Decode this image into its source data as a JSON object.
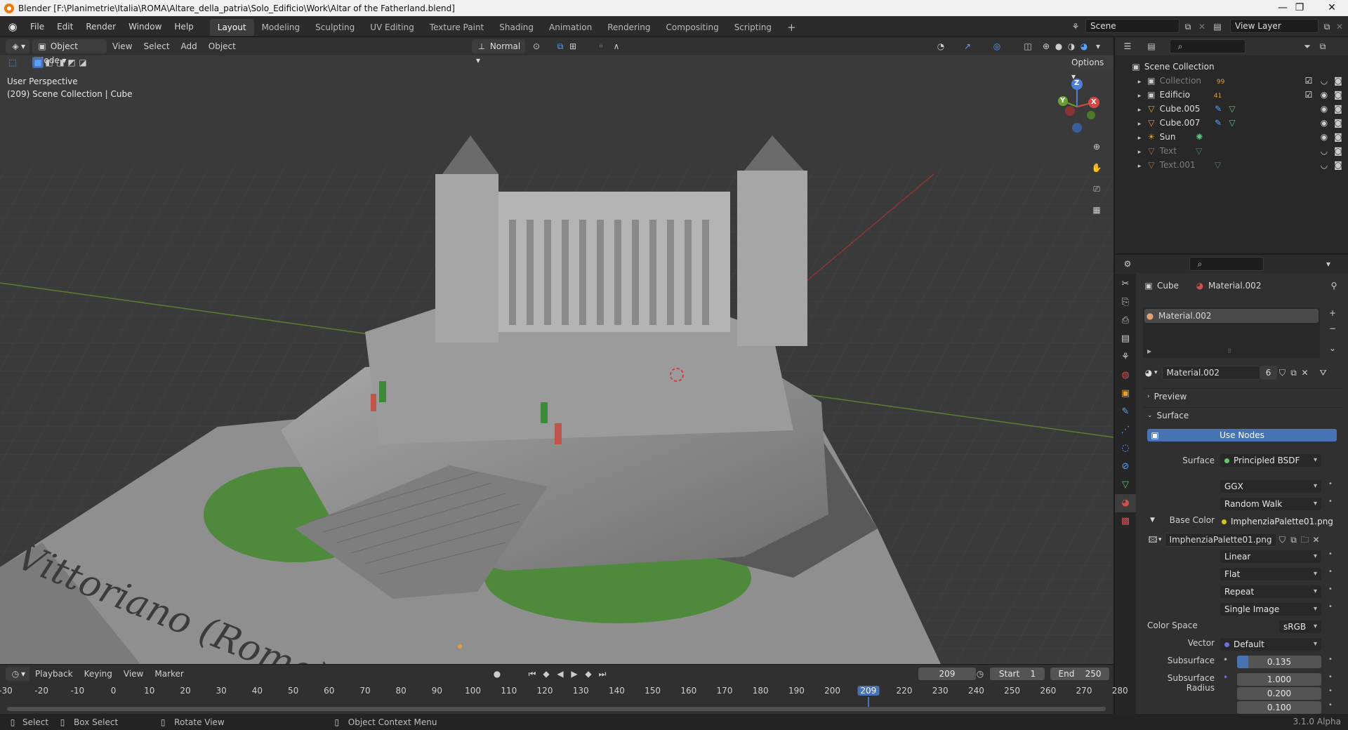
{
  "window": {
    "title": "Blender [F:\\Planimetrie\\Italia\\ROMA\\Altare_della_patria\\Solo_Edificio\\Work\\Altar of the Fatherland.blend]",
    "minimize": "—",
    "maximize": "❐",
    "close": "✕"
  },
  "menubar": {
    "menus": [
      "File",
      "Edit",
      "Render",
      "Window",
      "Help"
    ],
    "workspaces": [
      "Layout",
      "Modeling",
      "Sculpting",
      "UV Editing",
      "Texture Paint",
      "Shading",
      "Animation",
      "Rendering",
      "Compositing",
      "Scripting"
    ],
    "active_workspace": "Layout",
    "add_tab": "+",
    "scene": "Scene",
    "view_layer": "View Layer"
  },
  "viewport": {
    "mode": "Object Mode",
    "menus": [
      "View",
      "Select",
      "Add",
      "Object"
    ],
    "orientation": "Normal",
    "options": "Options",
    "info_line1": "User Perspective",
    "info_line2": "(209) Scene Collection | Cube",
    "scene_text": "Vittoriano (Rome)",
    "gizmo": {
      "z": "Z",
      "y": "Y",
      "x": "X"
    }
  },
  "outliner": {
    "root": "Scene Collection",
    "items": [
      {
        "name": "Collection",
        "dim": true,
        "badge": "99"
      },
      {
        "name": "Edificio",
        "dim": false,
        "badge": "41"
      },
      {
        "name": "Cube.005",
        "dim": false
      },
      {
        "name": "Cube.007",
        "dim": false
      },
      {
        "name": "Sun",
        "dim": false
      },
      {
        "name": "Text",
        "dim": true
      },
      {
        "name": "Text.001",
        "dim": true
      }
    ]
  },
  "properties": {
    "object_name": "Cube",
    "material_name": "Material.002",
    "slot": "Material.002",
    "material_users": "6",
    "panels": {
      "preview": "Preview",
      "surface": "Surface"
    },
    "use_nodes": "Use Nodes",
    "surface_label": "Surface",
    "surface_value": "Principled BSDF",
    "distribution": "GGX",
    "subsurface_method": "Random Walk",
    "base_color_label": "Base Color",
    "base_color_value": "ImphenziaPalette01.png",
    "image_name": "ImphenziaPalette01.png",
    "interpolation": "Linear",
    "projection": "Flat",
    "extension": "Repeat",
    "source": "Single Image",
    "color_space_label": "Color Space",
    "color_space": "sRGB",
    "vector_label": "Vector",
    "vector_value": "Default",
    "subsurface_label": "Subsurface",
    "subsurface_value": "0.135",
    "subsurface_fraction": 0.135,
    "subsurface_radius_label": "Subsurface Radius",
    "subsurface_radius": [
      "1.000",
      "0.200",
      "0.100"
    ]
  },
  "timeline": {
    "menus": [
      "Playback",
      "Keying",
      "View",
      "Marker"
    ],
    "current_frame": "209",
    "start_label": "Start",
    "start": "1",
    "end_label": "End",
    "end": "250",
    "ticks": [
      "-30",
      "-20",
      "-10",
      "0",
      "10",
      "20",
      "30",
      "40",
      "50",
      "60",
      "70",
      "80",
      "90",
      "100",
      "110",
      "120",
      "130",
      "140",
      "150",
      "160",
      "170",
      "180",
      "190",
      "200",
      "209",
      "220",
      "230",
      "240",
      "250",
      "260",
      "270",
      "280"
    ]
  },
  "statusbar": {
    "select": "Select",
    "box_select": "Box Select",
    "rotate_view": "Rotate View",
    "context_menu": "Object Context Menu",
    "version": "3.1.0 Alpha"
  }
}
